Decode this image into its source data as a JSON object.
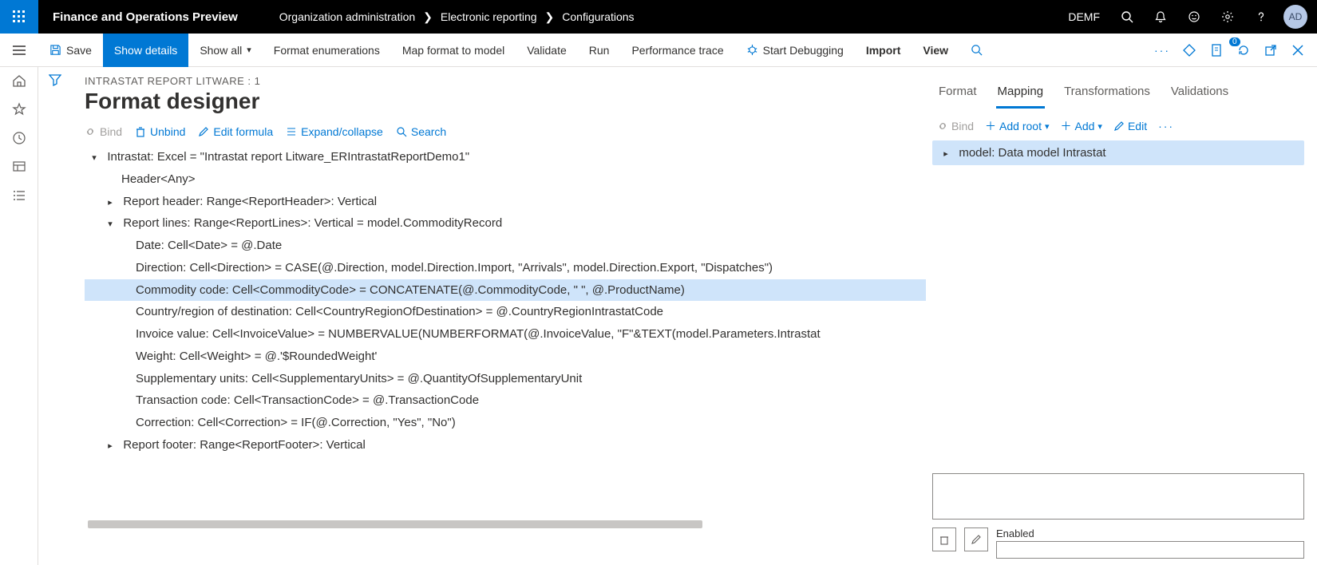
{
  "topbar": {
    "app_title": "Finance and Operations Preview",
    "breadcrumb": [
      "Organization administration",
      "Electronic reporting",
      "Configurations"
    ],
    "company": "DEMF",
    "avatar": "AD"
  },
  "cmdbar": {
    "save": "Save",
    "show_details": "Show details",
    "show_all": "Show all",
    "format_enum": "Format enumerations",
    "map_format": "Map format to model",
    "validate": "Validate",
    "run": "Run",
    "perf_trace": "Performance trace",
    "start_debug": "Start Debugging",
    "import": "Import",
    "view": "View",
    "attach_badge": "0"
  },
  "page": {
    "supertitle": "INTRASTAT REPORT LITWARE : 1",
    "title": "Format designer"
  },
  "toolbar": {
    "bind": "Bind",
    "unbind": "Unbind",
    "edit_formula": "Edit formula",
    "expand": "Expand/collapse",
    "search": "Search"
  },
  "tree": {
    "root": "Intrastat: Excel = \"Intrastat report Litware_ERIntrastatReportDemo1\"",
    "header": "Header<Any>",
    "report_header": "Report header: Range<ReportHeader>: Vertical",
    "report_lines": "Report lines: Range<ReportLines>: Vertical = model.CommodityRecord",
    "lines": {
      "date": "Date: Cell<Date> = @.Date",
      "direction": "Direction: Cell<Direction> = CASE(@.Direction, model.Direction.Import, \"Arrivals\", model.Direction.Export, \"Dispatches\")",
      "commodity": "Commodity code: Cell<CommodityCode> = CONCATENATE(@.CommodityCode, \" \", @.ProductName)",
      "country": "Country/region of destination: Cell<CountryRegionOfDestination> = @.CountryRegionIntrastatCode",
      "invoice": "Invoice value: Cell<InvoiceValue> = NUMBERVALUE(NUMBERFORMAT(@.InvoiceValue, \"F\"&TEXT(model.Parameters.Intrastat",
      "weight": "Weight: Cell<Weight> = @.'$RoundedWeight'",
      "supp": "Supplementary units: Cell<SupplementaryUnits> = @.QuantityOfSupplementaryUnit",
      "trans": "Transaction code: Cell<TransactionCode> = @.TransactionCode",
      "corr": "Correction: Cell<Correction> = IF(@.Correction, \"Yes\", \"No\")"
    },
    "report_footer": "Report footer: Range<ReportFooter>: Vertical"
  },
  "tabs": {
    "format": "Format",
    "mapping": "Mapping",
    "transformations": "Transformations",
    "validations": "Validations"
  },
  "maptools": {
    "bind": "Bind",
    "add_root": "Add root",
    "add": "Add",
    "edit": "Edit"
  },
  "maptree": {
    "root": "model: Data model Intrastat"
  },
  "bottom": {
    "enabled_label": "Enabled"
  }
}
